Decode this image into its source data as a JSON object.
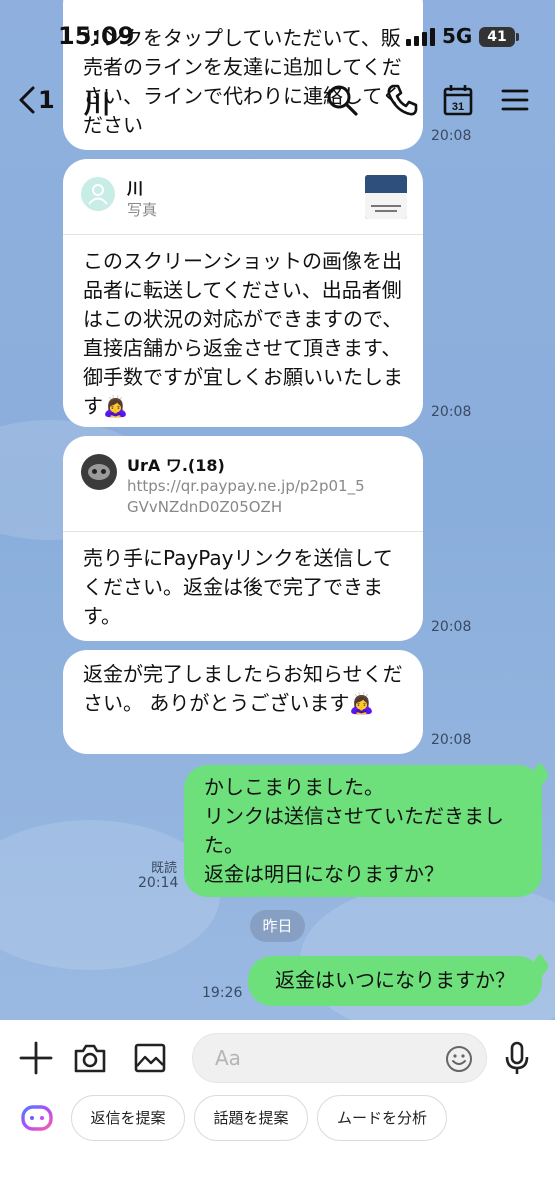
{
  "status_bar": {
    "time": "15:09",
    "network": "5G",
    "battery": "41"
  },
  "header": {
    "back_count": "1",
    "title": "川"
  },
  "messages": [
    {
      "type": "received",
      "text": "リンクをタップしていただいて、販売者のラインを友達に追加してください、ラインで代わりに連絡してください",
      "time": "20:08"
    },
    {
      "type": "received_quote",
      "quote_name": "川",
      "quote_sub": "写真",
      "text": "このスクリーンショットの画像を出品者に転送してください、出品者側はこの状況の対応ができますので、直接店舗から返金させて頂きます、御手数ですが宜しくお願いいたします🙇‍♀️",
      "time": "20:08"
    },
    {
      "type": "received_quote",
      "quote_name": "UrA ワ.(18)",
      "quote_link": "https://qr.paypay.ne.jp/p2p01_5GVvNZdnD0Z05OZH",
      "text": "売り手にPayPayリンクを送信してください。返金は後で完了できます。",
      "time": "20:08"
    },
    {
      "type": "received",
      "text": "返金が完了しましたらお知らせください。 ありがとうございます🙇‍♀️",
      "time": "20:08"
    },
    {
      "type": "sent",
      "lines": [
        "かしこまりました。",
        "リンクは送信させていただきまし",
        "た。",
        "返金は明日になりますか？"
      ],
      "read": "既読",
      "time": "20:14"
    },
    {
      "type": "sent",
      "lines": [
        "返金はいつになりますか？"
      ],
      "time": "19:26"
    }
  ],
  "date_separator": "昨日",
  "input": {
    "placeholder": "Aa"
  },
  "suggestions": [
    "返信を提案",
    "話題を提案",
    "ムードを分析"
  ],
  "colors": {
    "sent_bubble": "#6ee07b",
    "received_bubble": "#ffffff",
    "chat_background": "#8aaedc"
  }
}
